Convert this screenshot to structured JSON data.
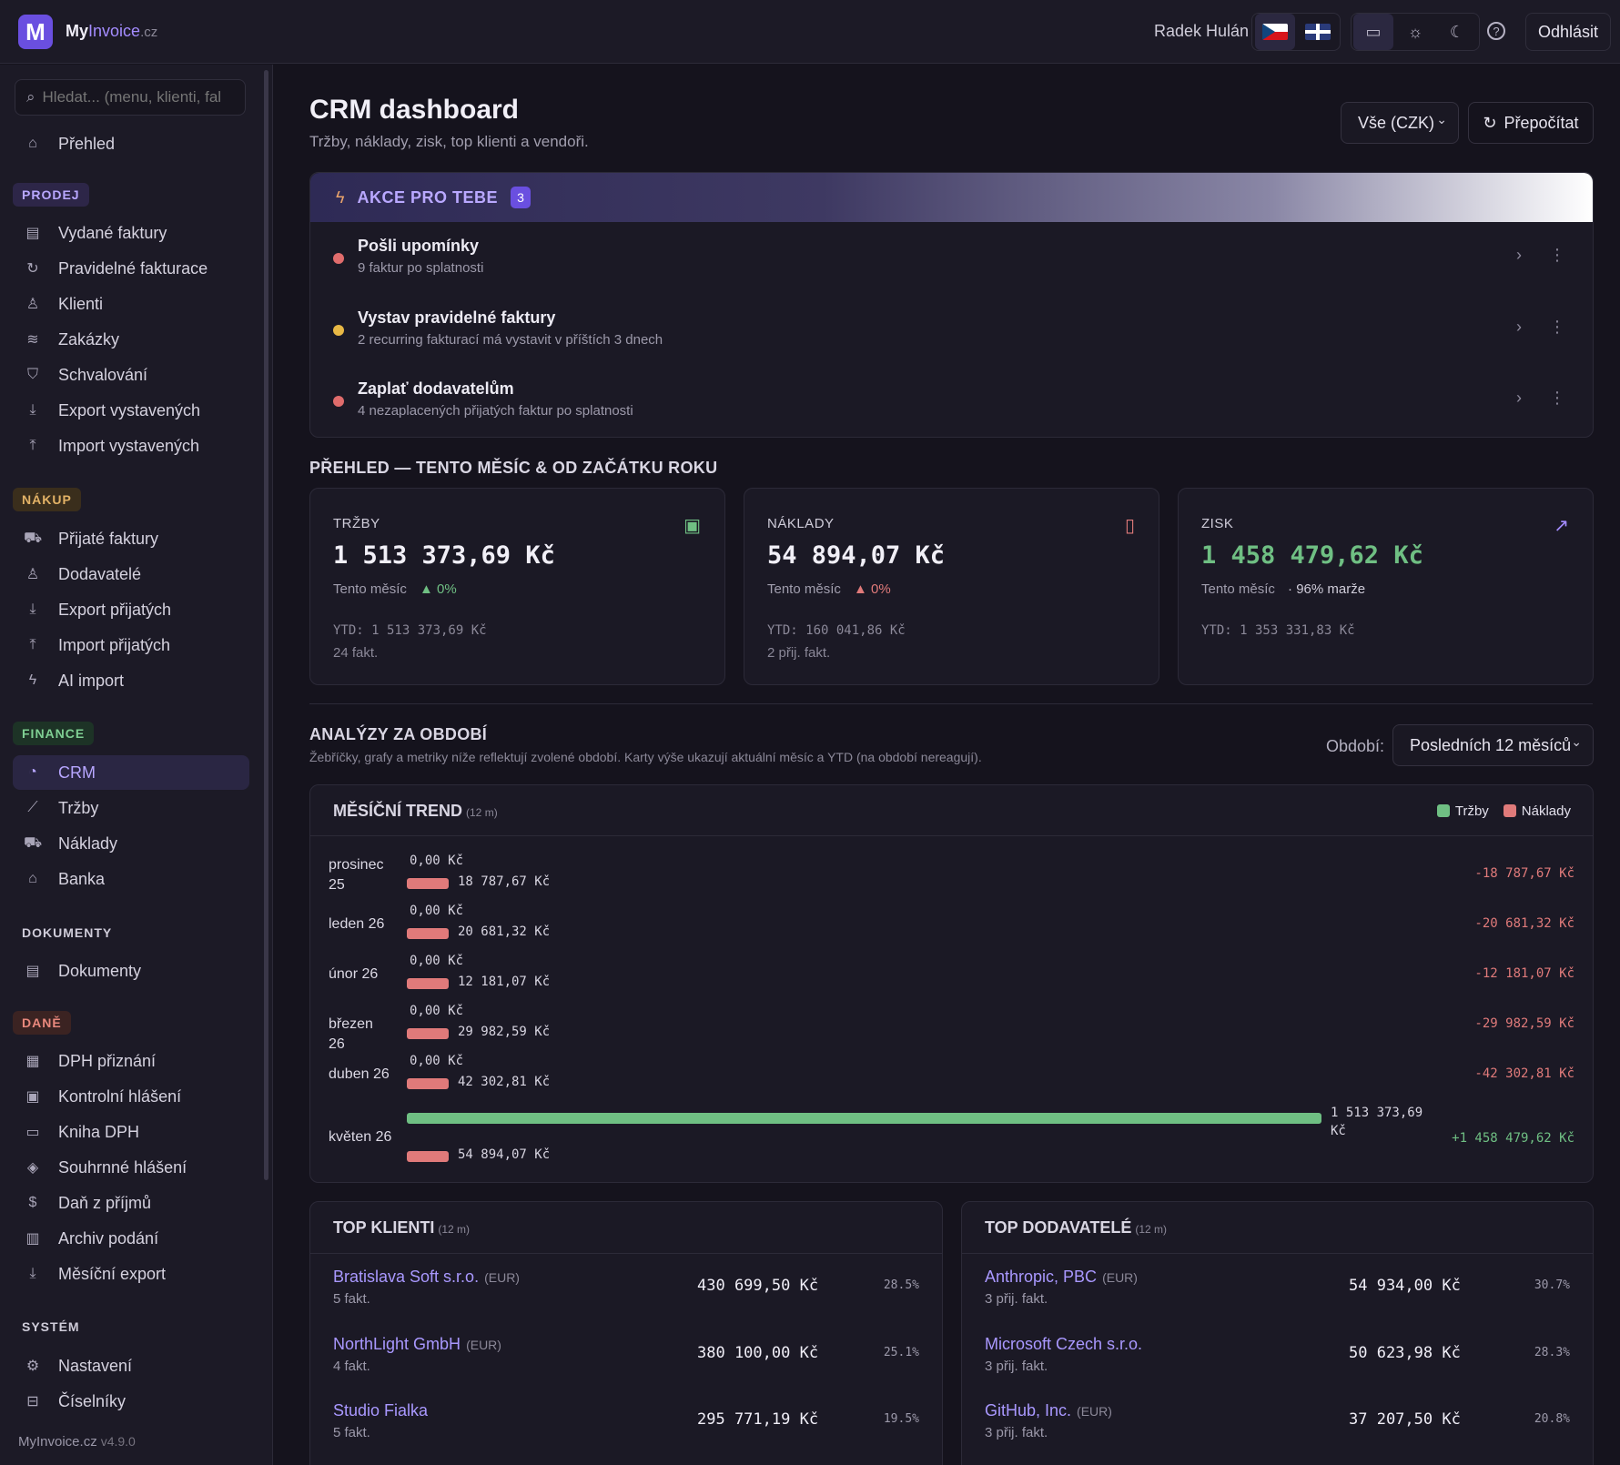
{
  "topbar": {
    "brand_my": "My",
    "brand_invoice": "Invoice",
    "brand_tld": ".cz",
    "user_name": "Radek Hulán",
    "logout_label": "Odhlásit"
  },
  "sidebar": {
    "search_placeholder": "Hledat... (menu, klienti, fal",
    "overview": "Přehled",
    "sections": {
      "prodej": "PRODEJ",
      "nakup": "NÁKUP",
      "finance": "FINANCE",
      "dokumenty": "DOKUMENTY",
      "dane": "DANĚ",
      "system": "SYSTÉM"
    },
    "prodej_items": [
      "Vydané faktury",
      "Pravidelné fakturace",
      "Klienti",
      "Zakázky",
      "Schvalování",
      "Export vystavených",
      "Import vystavených"
    ],
    "nakup_items": [
      "Přijaté faktury",
      "Dodavatelé",
      "Export přijatých",
      "Import přijatých",
      "AI import"
    ],
    "finance_items": [
      "CRM",
      "Tržby",
      "Náklady",
      "Banka"
    ],
    "dokumenty_items": [
      "Dokumenty"
    ],
    "dane_items": [
      "DPH přiznání",
      "Kontrolní hlášení",
      "Kniha DPH",
      "Souhrnné hlášení",
      "Daň z příjmů",
      "Archiv podání",
      "Měsíční export"
    ],
    "system_items": [
      "Nastavení",
      "Číselníky"
    ],
    "version_app": "MyInvoice.cz",
    "version": "v4.9.0"
  },
  "header": {
    "title": "CRM dashboard",
    "subtitle": "Tržby, náklady, zisk, top klienti a vendoři.",
    "currency_select": "Vše (CZK)",
    "recalc_label": "Přepočítat"
  },
  "actions": {
    "title": "AKCE PRO TEBE",
    "count": "3",
    "items": [
      {
        "title": "Pošli upomínky",
        "desc": "9 faktur po splatnosti",
        "color": "#e06c6c"
      },
      {
        "title": "Vystav pravidelné faktury",
        "desc": "2 recurring fakturací má vystavit v příštích 3 dnech",
        "color": "#e8b845"
      },
      {
        "title": "Zaplať dodavatelům",
        "desc": "4 nezaplacených přijatých faktur po splatnosti",
        "color": "#e06c6c"
      }
    ]
  },
  "overview": {
    "title": "PŘEHLED — TENTO MĚSÍC & OD ZAČÁTKU ROKU",
    "cards": [
      {
        "label": "TRŽBY",
        "value": "1 513 373,69 Kč",
        "period": "Tento měsíc",
        "delta": "▲ 0%",
        "ytd": "YTD: 1 513 373,69 Kč",
        "count": "24 fakt."
      },
      {
        "label": "NÁKLADY",
        "value": "54 894,07 Kč",
        "period": "Tento měsíc",
        "delta": "▲ 0%",
        "ytd": "YTD: 160 041,86 Kč",
        "count": "2 přij. fakt."
      },
      {
        "label": "ZISK",
        "value": "1 458 479,62 Kč",
        "period": "Tento měsíc",
        "delta": "· 96% marže",
        "ytd": "YTD: 1 353 331,83 Kč",
        "count": ""
      }
    ]
  },
  "analysis": {
    "title": "ANALÝZY ZA OBDOBÍ",
    "subtitle": "Žebříčky, grafy a metriky níže reflektují zvolené období. Karty výše ukazují aktuální měsíc a YTD (na období nereagují).",
    "period_label": "Období:",
    "period_value": "Posledních 12 měsíců"
  },
  "trend": {
    "title": "MĚSÍČNÍ TREND",
    "range": "(12 m)",
    "legend_revenue": "Tržby",
    "legend_costs": "Náklady",
    "color_revenue": "#6fbf83",
    "color_costs": "#e07a7a",
    "max_value": 1513373.69,
    "months": [
      {
        "label": "prosinec 25",
        "revenue": 0,
        "revenue_text": "0,00 Kč",
        "costs": 18787.67,
        "costs_text": "18 787,67 Kč",
        "net": "-18 787,67 Kč"
      },
      {
        "label": "leden 26",
        "revenue": 0,
        "revenue_text": "0,00 Kč",
        "costs": 20681.32,
        "costs_text": "20 681,32 Kč",
        "net": "-20 681,32 Kč"
      },
      {
        "label": "únor 26",
        "revenue": 0,
        "revenue_text": "0,00 Kč",
        "costs": 12181.07,
        "costs_text": "12 181,07 Kč",
        "net": "-12 181,07 Kč"
      },
      {
        "label": "březen 26",
        "revenue": 0,
        "revenue_text": "0,00 Kč",
        "costs": 29982.59,
        "costs_text": "29 982,59 Kč",
        "net": "-29 982,59 Kč"
      },
      {
        "label": "duben 26",
        "revenue": 0,
        "revenue_text": "0,00 Kč",
        "costs": 42302.81,
        "costs_text": "42 302,81 Kč",
        "net": "-42 302,81 Kč"
      },
      {
        "label": "květen 26",
        "revenue": 1513373.69,
        "revenue_text": "1 513 373,69 Kč",
        "costs": 54894.07,
        "costs_text": "54 894,07 Kč",
        "net": "+1 458 479,62 Kč"
      }
    ]
  },
  "top_clients": {
    "title": "TOP KLIENTI",
    "range": "(12 m)",
    "rows": [
      {
        "name": "Bratislava Soft s.r.o.",
        "currency": "(EUR)",
        "count": "5 fakt.",
        "amount": "430 699,50 Kč",
        "share": "28.5%"
      },
      {
        "name": "NorthLight GmbH",
        "currency": "(EUR)",
        "count": "4 fakt.",
        "amount": "380 100,00 Kč",
        "share": "25.1%"
      },
      {
        "name": "Studio Fialka",
        "currency": "",
        "count": "5 fakt.",
        "amount": "295 771,19 Kč",
        "share": "19.5%"
      }
    ]
  },
  "top_vendors": {
    "title": "TOP DODAVATELÉ",
    "range": "(12 m)",
    "rows": [
      {
        "name": "Anthropic, PBC",
        "currency": "(EUR)",
        "count": "3 přij. fakt.",
        "amount": "54 934,00 Kč",
        "share": "30.7%"
      },
      {
        "name": "Microsoft Czech s.r.o.",
        "currency": "",
        "count": "3 přij. fakt.",
        "amount": "50 623,98 Kč",
        "share": "28.3%"
      },
      {
        "name": "GitHub, Inc.",
        "currency": "(EUR)",
        "count": "3 přij. fakt.",
        "amount": "37 207,50 Kč",
        "share": "20.8%"
      }
    ]
  }
}
